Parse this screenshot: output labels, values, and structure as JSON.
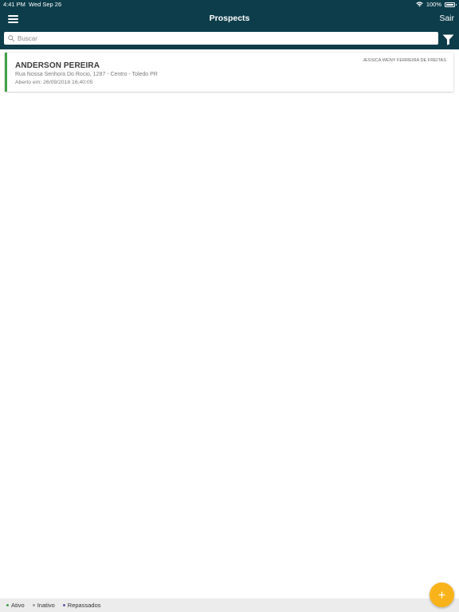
{
  "status_bar": {
    "time": "4:41 PM",
    "date": "Wed Sep 26",
    "battery": "100%",
    "icons": [
      "wifi-icon",
      "battery-icon"
    ]
  },
  "nav": {
    "title": "Prospects",
    "logout_label": "Sair",
    "icons": [
      "menu-icon"
    ]
  },
  "search": {
    "placeholder": "Buscar",
    "value": "",
    "icons": [
      "search-icon",
      "filter-icon"
    ]
  },
  "prospects": [
    {
      "name": "ANDERSON PEREIRA",
      "address": "Rua Nossa Senhora Do Rocio, 1287 - Centro - Toledo PR",
      "opened": "Aberto em: 26/09/2018 16:40:05",
      "owner": "JESSICA WENY FERREIRA DE FREITAS",
      "status": "Ativo"
    }
  ],
  "legend": [
    {
      "label": "Ativo",
      "color": "#43a047"
    },
    {
      "label": "Inativo",
      "color": "#9e9e9e"
    },
    {
      "label": "Repassados",
      "color": "#5c5fa8"
    }
  ],
  "colors": {
    "header": "#0d3d4a",
    "accent": "#f9b31a",
    "active": "#43a047"
  },
  "fab": {
    "icon": "plus-icon"
  }
}
